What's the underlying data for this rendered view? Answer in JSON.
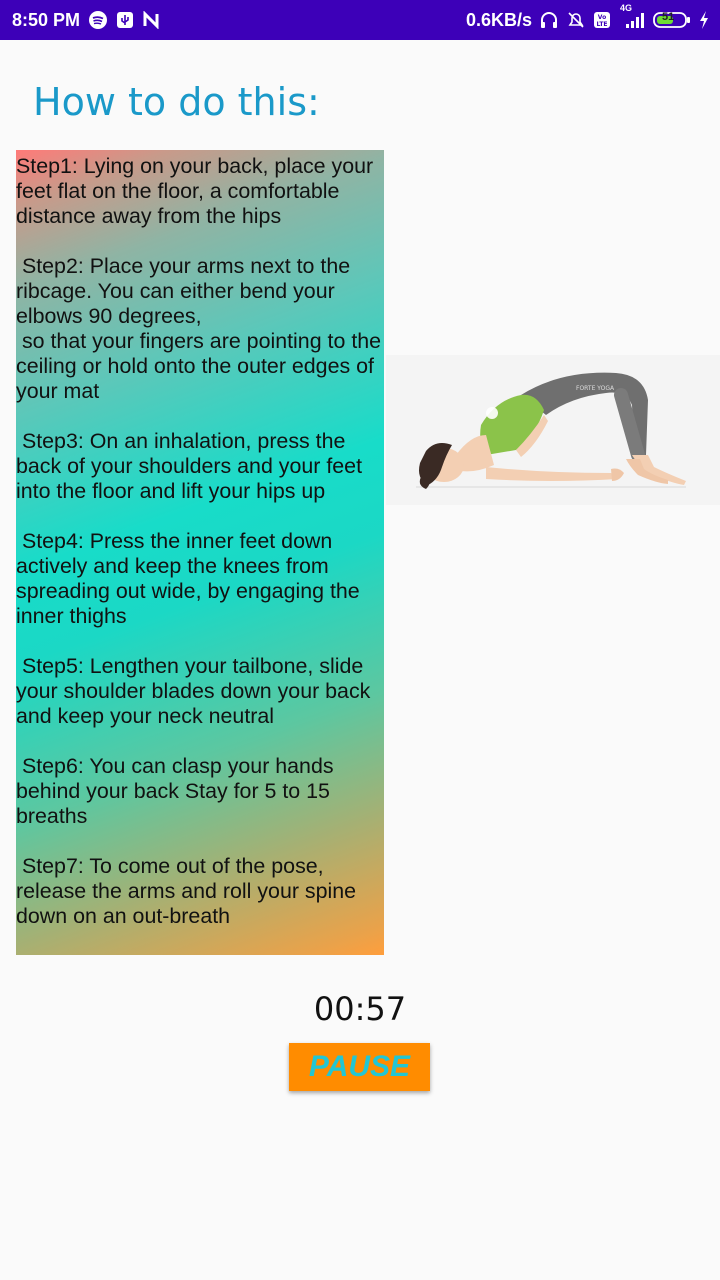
{
  "status_bar": {
    "time": "8:50 PM",
    "network_speed": "0.6KB/s",
    "network_type": "4G",
    "battery": "51",
    "icons": [
      "spotify-icon",
      "usb-icon",
      "n-icon",
      "headset-icon",
      "alarm-off-icon",
      "volte-icon",
      "signal-icon",
      "battery-icon",
      "charging-icon"
    ]
  },
  "header": {
    "title": "How to do this:"
  },
  "steps": {
    "text": "Step1: Lying on your back, place your feet flat on the floor, a comfortable distance away from the hips\n\n Step2: Place your arms next to the ribcage. You can either bend your elbows 90 degrees,\n so that your fingers are pointing to the ceiling or hold onto the outer edges of your mat\n\n Step3: On an inhalation, press the back of your shoulders and your feet into the floor and lift your hips up\n\n Step4: Press the inner feet down actively and keep the knees from spreading out wide, by engaging the inner thighs\n\n Step5: Lengthen your tailbone, slide your shoulder blades down your back and keep your neck neutral\n\n Step6: You can clasp your hands behind your back Stay for 5 to 15 breaths\n\n Step7: To come out of the pose, release the arms and roll your spine down on an out-breath"
  },
  "pose_image": {
    "brand": "FORTE YOGA",
    "colors": {
      "top": "#8bc34a",
      "leggings": "#6f6f6f",
      "skin": "#f3cfb3",
      "hair": "#3a2a24"
    }
  },
  "timer": {
    "value": "00:57"
  },
  "controls": {
    "pause_label": "PAUSE"
  }
}
